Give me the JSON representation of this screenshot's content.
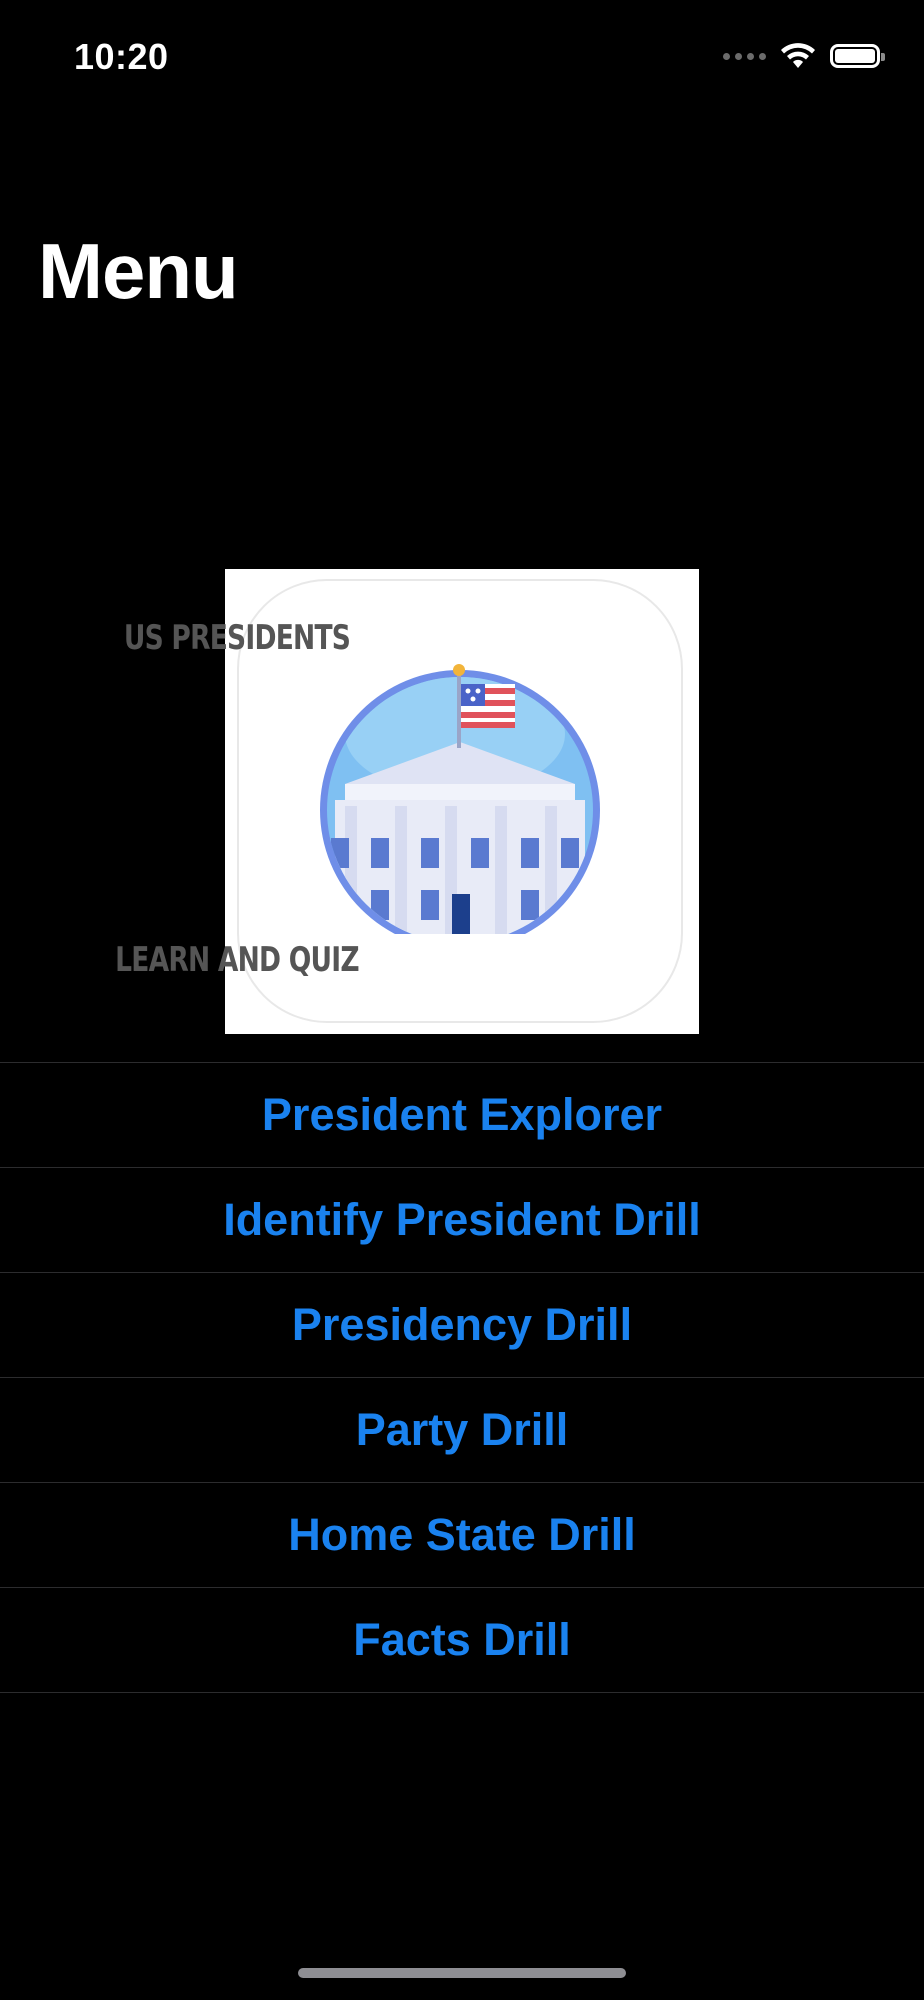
{
  "status_bar": {
    "time": "10:20",
    "icons": [
      "cellular-dots-icon",
      "wifi-icon",
      "battery-icon"
    ]
  },
  "nav": {
    "title": "Menu"
  },
  "logo": {
    "text_top": "US PRESIDENTS",
    "text_bottom": "LEARN AND QUIZ",
    "icon": "white-house-flag-icon"
  },
  "menu": {
    "items": [
      {
        "label": "President Explorer"
      },
      {
        "label": "Identify President Drill"
      },
      {
        "label": "Presidency Drill"
      },
      {
        "label": "Party Drill"
      },
      {
        "label": "Home State Drill"
      },
      {
        "label": "Facts Drill"
      }
    ]
  },
  "colors": {
    "background": "#000000",
    "accent": "#1a82ef",
    "separator": "#2c2c2e"
  }
}
